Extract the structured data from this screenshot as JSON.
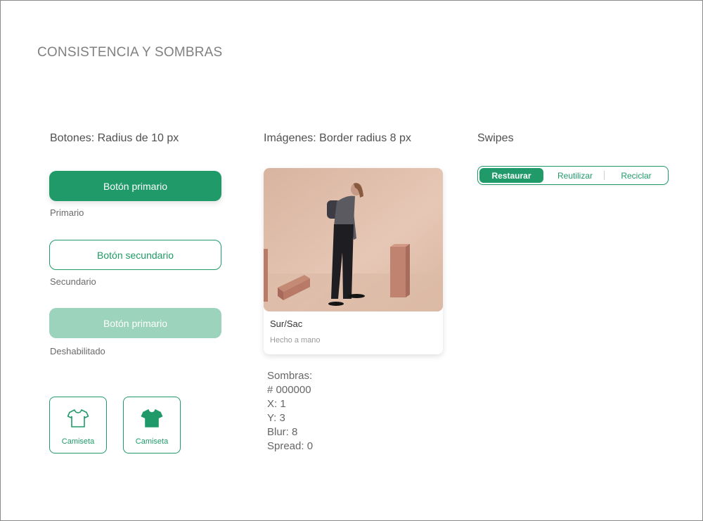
{
  "page": {
    "title": "CONSISTENCIA Y SOMBRAS"
  },
  "buttons_section": {
    "title": "Botones:  Radius de 10 px",
    "primary_label": "Botón primario",
    "primary_caption": "Primario",
    "secondary_label": "Botón secundario",
    "secondary_caption": "Secundario",
    "disabled_label": "Botón primario",
    "disabled_caption": "Deshabilitado",
    "tiles": [
      {
        "label": "Camiseta",
        "icon": "tshirt-outline-icon"
      },
      {
        "label": "Camiseta",
        "icon": "tshirt-filled-icon"
      }
    ]
  },
  "images_section": {
    "title": "Imágenes: Border radius 8 px",
    "card": {
      "title": "Sur/Sac",
      "subtitle": "Hecho a mano",
      "image": "model-with-backpack-photo"
    },
    "shadows": {
      "heading": "Sombras:",
      "color": "# 000000",
      "x": "X: 1",
      "y": "Y: 3",
      "blur": "Blur: 8",
      "spread": "Spread: 0"
    }
  },
  "swipes_section": {
    "title": "Swipes",
    "segments": [
      "Restaurar",
      "Reutilizar",
      "Reciclar"
    ],
    "active_index": 0
  },
  "colors": {
    "accent": "#1f9a68",
    "disabled": "#9bd3bc",
    "text": "#555555"
  }
}
